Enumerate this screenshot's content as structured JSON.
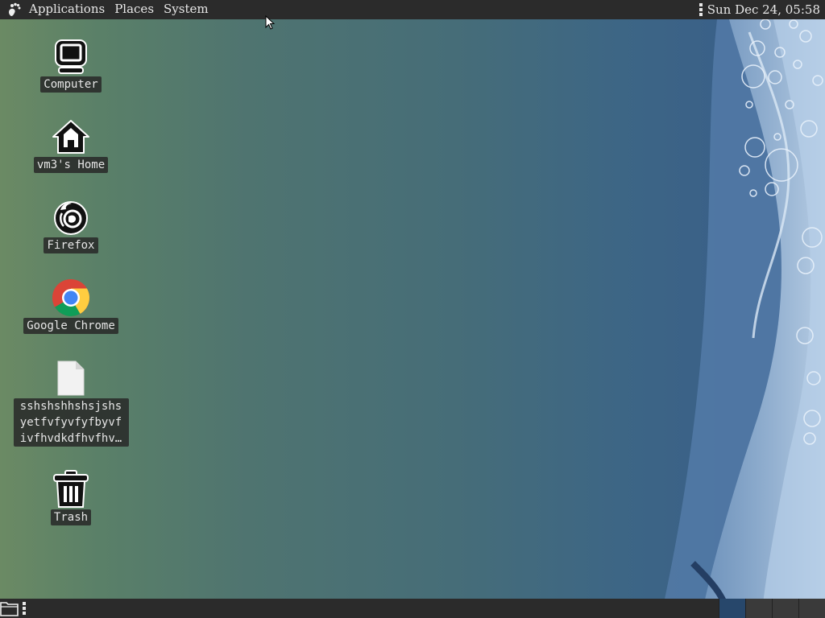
{
  "top_panel": {
    "menus": [
      "Applications",
      "Places",
      "System"
    ],
    "clock": "Sun Dec 24, 05:58"
  },
  "desktop_icons": [
    {
      "label": "Computer",
      "icon": "computer-icon"
    },
    {
      "label": "vm3's Home",
      "icon": "home-folder-icon"
    },
    {
      "label": "Firefox",
      "icon": "firefox-icon"
    },
    {
      "label": "Google Chrome",
      "icon": "chrome-icon"
    },
    {
      "label": "sshshshhshsjshs yetfvfyvfyfbyvf ivfhvdkdfhvfhv…",
      "icon": "text-file-icon"
    },
    {
      "label": "Trash",
      "icon": "trash-icon"
    }
  ],
  "bottom_panel": {
    "show_desktop_icon": "show-desktop-icon",
    "workspaces": 4
  },
  "colors": {
    "panel_bg": "#2b2b2b",
    "panel_text": "#e8e8e8",
    "label_bg": "#282828",
    "active_workspace": "#27476b"
  }
}
